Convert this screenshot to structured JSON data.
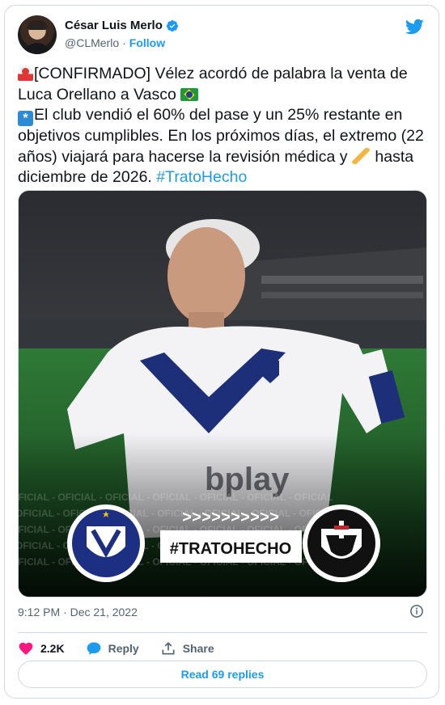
{
  "author": {
    "name": "César Luis Merlo",
    "handle": "@CLMerlo",
    "separator": "·",
    "follow_label": "Follow",
    "verified": true
  },
  "tweet": {
    "line1": "[CONFIRMADO] Vélez acordó de palabra la venta de",
    "line2": "Luca Orellano a Vasco",
    "line3": "El club vendió el 60% del pase y un 25% restante en",
    "line4": "objetivos cumplibles. En los próximos días, el extremo (22",
    "line5": "años) viajará para hacerse la revisión médica y",
    "line5_end": "hasta",
    "line6": "diciembre de 2026.",
    "hashtag": "#TratoHecho",
    "emojis": [
      "rotating-light-emoji",
      "brazil-flag-emoji",
      "asterisk-emoji",
      "writing-hand-emoji"
    ]
  },
  "media": {
    "banner_text": "#TRATOHECHO",
    "arrows": ">>>>>>>>>>",
    "sponsor_text": "bplay",
    "watermark_text": "OFICIAL - OFICIAL - OFICIAL - OFICIAL - OFICIAL - OFICIAL - OFICIAL"
  },
  "meta": {
    "time": "9:12 PM",
    "sep": "·",
    "date": "Dec 21, 2022"
  },
  "actions": {
    "likes": "2.2K",
    "reply_label": "Reply",
    "share_label": "Share"
  },
  "read_replies": "Read 69 replies",
  "colors": {
    "accent": "#1d9bf0",
    "like": "#f91880",
    "text": "#0f1419",
    "muted": "#536471",
    "border": "#cfd9de"
  }
}
